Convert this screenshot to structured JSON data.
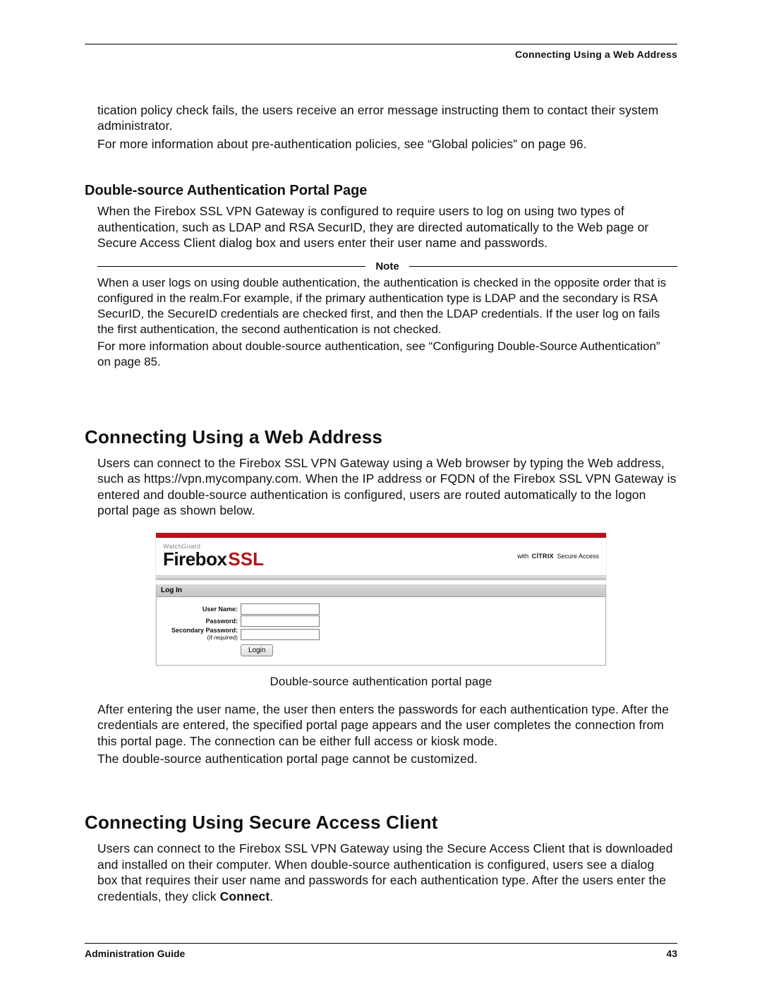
{
  "header": {
    "running_title": "Connecting Using a Web Address"
  },
  "intro": {
    "p1": "tication policy check fails, the users receive an error message instructing them to contact their system administrator.",
    "p2": "For more information about pre-authentication policies, see “Global policies” on page 96."
  },
  "section_double": {
    "title": "Double-source Authentication Portal Page",
    "p1": "When the Firebox SSL VPN Gateway is configured to require users to log on using two types of authentication, such as LDAP and RSA SecurID, they are directed automatically to the Web page or Secure Access Client dialog box and users enter their user name and passwords.",
    "note_label": "Note",
    "note_body1": "When a user logs on using double authentication, the authentication is checked in the opposite order that is configured in the realm.For example, if the primary authentication type is LDAP and the secondary is RSA SecurID, the SecureID credentials are checked first, and then the LDAP credentials. If the user log on fails the first authentication, the second authentication is not checked.",
    "note_body2": "For more information about double-source authentication, see “Configuring Double-Source Authentication” on page 85."
  },
  "section_web": {
    "title": "Connecting Using a Web Address",
    "p1": "Users can connect to the Firebox SSL VPN Gateway using a Web browser by typing the Web address, such as https://vpn.mycompany.com. When the IP address or FQDN of the Firebox SSL VPN Gateway is entered and double-source authentication is configured, users are routed automatically to the logon portal page as shown below.",
    "portal": {
      "brand_small": "WatchGuard",
      "brand_firebox": "Firebox",
      "brand_ssl": "SSL",
      "citrix_prefix": "with",
      "citrix_brand": "CİTRIX",
      "citrix_suffix": "Secure Access",
      "login_header": "Log In",
      "label_user": "User Name:",
      "label_pass": "Password:",
      "label_pass2": "Secondary Password:",
      "label_pass2_sub": "(if required)",
      "login_button": "Login"
    },
    "caption": "Double-source authentication portal page",
    "p2": "After entering the user name, the user then enters the passwords for each authentication type. After the credentials are entered, the specified portal page appears and the user completes the connection from this portal page. The connection can be either full access or kiosk mode.",
    "p3": "The double-source authentication portal page cannot be customized."
  },
  "section_client": {
    "title": "Connecting Using Secure Access Client",
    "p1_a": "Users can connect to the Firebox SSL VPN Gateway using the Secure Access Client that is downloaded and installed on their computer. When double-source authentication is configured, users see a dialog box that requires their user name and passwords for each authentication type. After the users enter the credentials, they click ",
    "p1_bold": "Connect",
    "p1_b": "."
  },
  "footer": {
    "left": "Administration Guide",
    "right": "43"
  }
}
